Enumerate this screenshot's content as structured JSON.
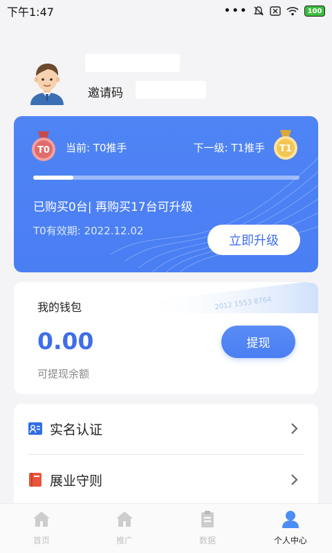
{
  "status_bar": {
    "time": "下午1:47",
    "dots": "•••",
    "battery": "100"
  },
  "profile": {
    "invite_label": "邀请码"
  },
  "level_card": {
    "current_level": "当前: T0推手",
    "next_level": "下一级: T1推手",
    "current_medal": "T0",
    "next_medal": "T1",
    "progress": 0.15,
    "purchase_text": "已购买0台| 再购买17台可升级",
    "validity": "T0有效期: 2022.12.02",
    "upgrade_button": "立即升级"
  },
  "wallet": {
    "title": "我的钱包",
    "amount": "0.00",
    "caption": "可提现余额",
    "withdraw_button": "提现",
    "card_number": "2012  1553  8764"
  },
  "menu": {
    "items": [
      {
        "label": "实名认证",
        "icon": "id-card-icon"
      },
      {
        "label": "展业守则",
        "icon": "book-icon"
      }
    ]
  },
  "bottom_nav": {
    "items": [
      {
        "label": "首页",
        "icon": "home-icon",
        "active": false
      },
      {
        "label": "推广",
        "icon": "home-icon",
        "active": false
      },
      {
        "label": "数据",
        "icon": "clipboard-icon",
        "active": false
      },
      {
        "label": "个人中心",
        "icon": "user-icon",
        "active": true
      }
    ]
  },
  "colors": {
    "accent": "#4a7ef3",
    "background": "#f4f4f6"
  }
}
